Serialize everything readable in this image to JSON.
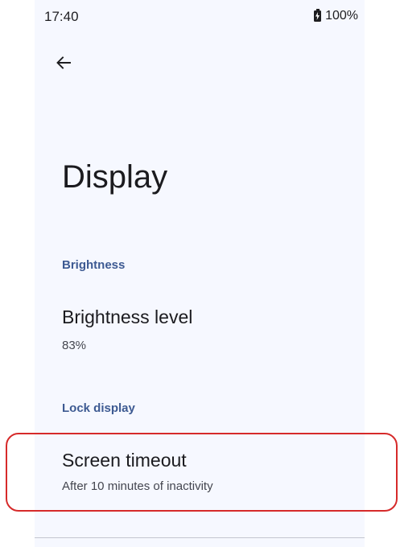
{
  "status_bar": {
    "time": "17:40",
    "battery_icon": "battery-charging-icon",
    "battery_level": "100%"
  },
  "toolbar": {
    "back_icon": "arrow-back-icon"
  },
  "page": {
    "title": "Display"
  },
  "sections": [
    {
      "header": "Brightness",
      "items": [
        {
          "title": "Brightness level",
          "summary": "83%"
        }
      ]
    },
    {
      "header": "Lock display",
      "items": [
        {
          "title": "Screen timeout",
          "summary": "After 10 minutes of inactivity"
        }
      ]
    }
  ],
  "colors": {
    "background": "#f6f8ff",
    "section_header": "#3d5a92",
    "highlight_outline": "#d62a2a"
  }
}
